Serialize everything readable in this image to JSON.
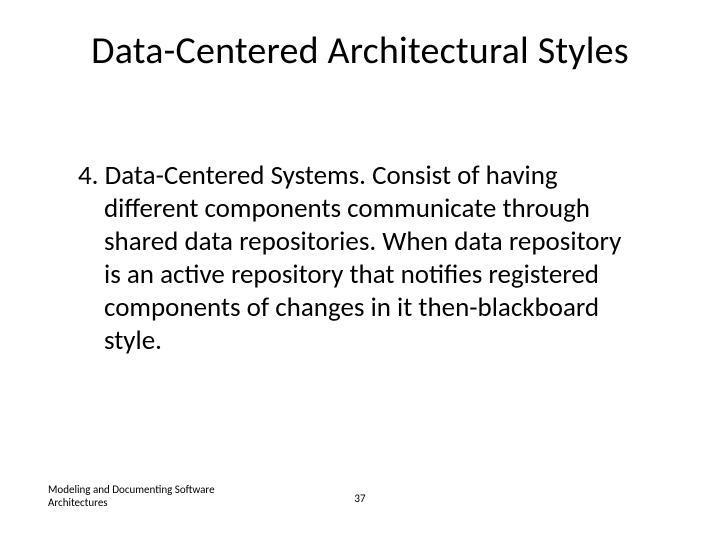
{
  "title": "Data-Centered Architectural Styles",
  "body": {
    "number": "4.",
    "text": "Data-Centered Systems. Consist of having different components communicate through shared data repositories. When data repository is an active repository that notifies registered components of changes in it then-blackboard style."
  },
  "footer": {
    "left": "Modeling and Documenting Software Architectures",
    "pageNumber": "37"
  }
}
